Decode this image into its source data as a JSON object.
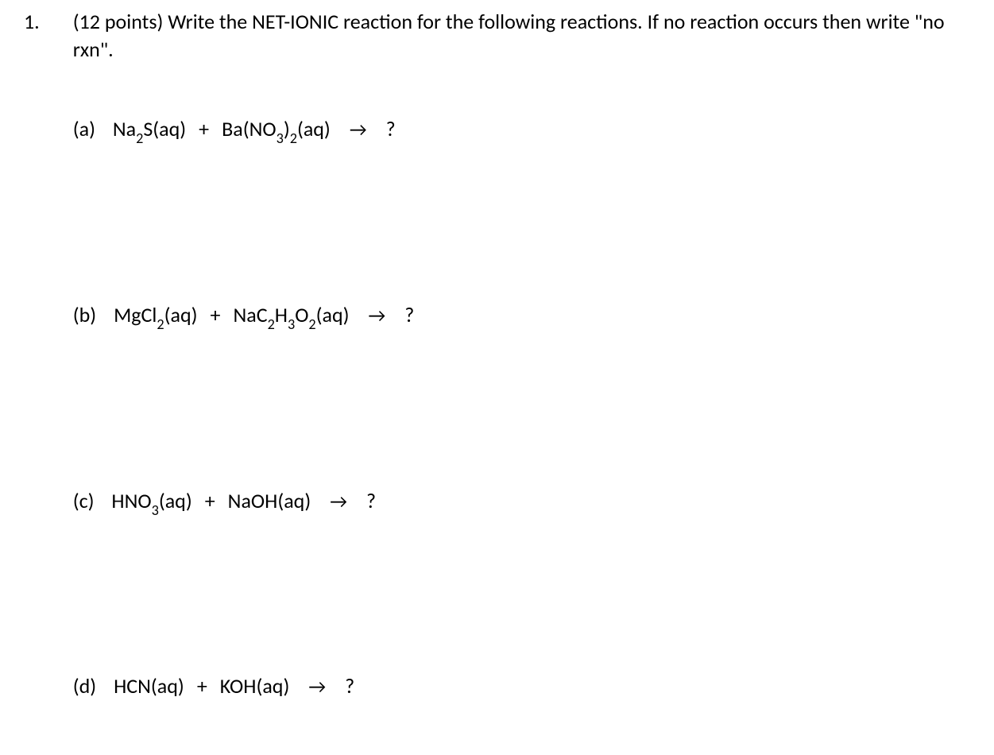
{
  "question": {
    "number": "1.",
    "prompt": "(12 points) Write the NET-IONIC reaction for the following reactions.  If no reaction occurs then write \"no rxn\".",
    "subparts": [
      {
        "label": "(a)",
        "reactants": [
          {
            "formula_html": "Na<span class=\"sub\">2</span>S(aq)"
          },
          {
            "formula_html": "Ba(NO<span class=\"sub\">3</span>)<span class=\"sub\">2</span>(aq)"
          }
        ],
        "arrow": "→",
        "product_placeholder": "?"
      },
      {
        "label": "(b)",
        "reactants": [
          {
            "formula_html": "MgCl<span class=\"sub\">2</span>(aq)"
          },
          {
            "formula_html": "NaC<span class=\"sub\">2</span>H<span class=\"sub\">3</span>O<span class=\"sub\">2</span>(aq)"
          }
        ],
        "arrow": "→",
        "product_placeholder": "?"
      },
      {
        "label": "(c)",
        "reactants": [
          {
            "formula_html": "HNO<span class=\"sub\">3</span>(aq)"
          },
          {
            "formula_html": "NaOH(aq)"
          }
        ],
        "arrow": "→",
        "product_placeholder": "?"
      },
      {
        "label": "(d)",
        "reactants": [
          {
            "formula_html": "HCN(aq)"
          },
          {
            "formula_html": "KOH(aq)"
          }
        ],
        "arrow": "→",
        "product_placeholder": "?"
      }
    ],
    "plus_symbol": "+"
  }
}
